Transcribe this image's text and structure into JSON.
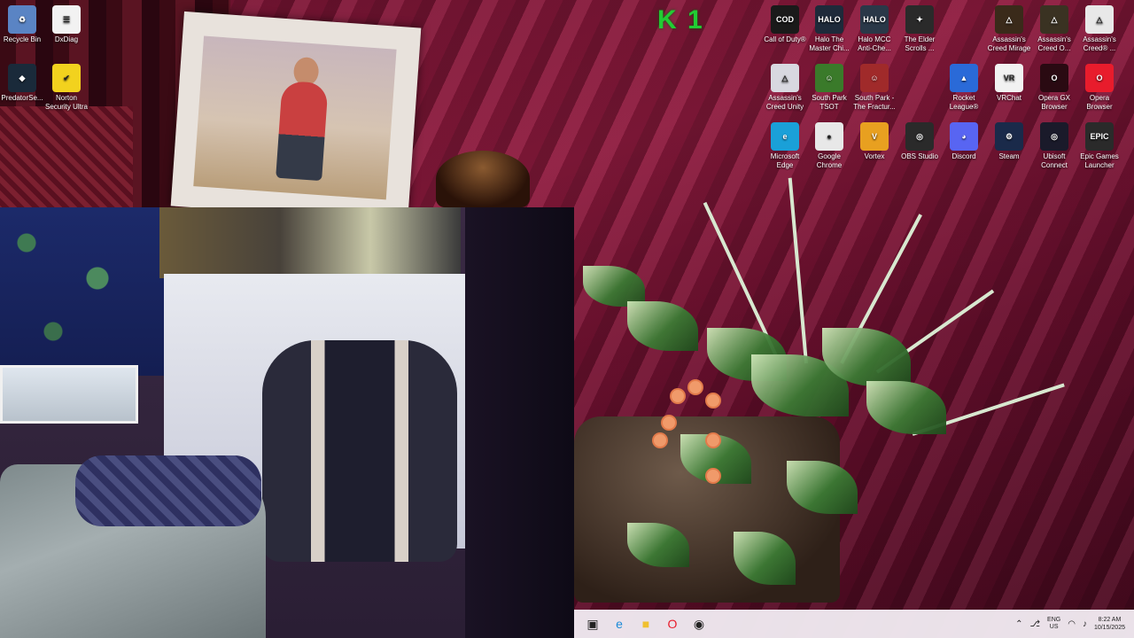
{
  "desktop": {
    "icons": [
      {
        "id": "recycle-bin",
        "label": "Recycle Bin",
        "glyph": "♻",
        "color": "#5a84c4"
      },
      {
        "id": "dxdiag",
        "label": "DxDiag",
        "glyph": "☰",
        "color": "#f2f2f2"
      },
      {
        "id": "predatorsense",
        "label": "PredatorSe...",
        "glyph": "◆",
        "color": "#1a2a3a"
      },
      {
        "id": "norton",
        "label": "Norton Security Ultra",
        "glyph": "✔",
        "color": "#f2d21e"
      },
      {
        "id": "call-of-duty",
        "label": "Call of Duty®",
        "glyph": "COD",
        "color": "#1a1a1a"
      },
      {
        "id": "halo-mc",
        "label": "Halo The Master Chi...",
        "glyph": "HALO",
        "color": "#1e2a3a"
      },
      {
        "id": "halo-mcc",
        "label": "Halo MCC Anti-Che...",
        "glyph": "HALO",
        "color": "#2a3848"
      },
      {
        "id": "elder-scrolls",
        "label": "The Elder Scrolls ...",
        "glyph": "✦",
        "color": "#2a2a2a"
      },
      {
        "id": "ac-mirage",
        "label": "Assassin's Creed Mirage",
        "glyph": "△",
        "color": "#3a2a1a"
      },
      {
        "id": "ac-odyssey",
        "label": "Assassin's Creed O...",
        "glyph": "△",
        "color": "#3a3222"
      },
      {
        "id": "ac-other",
        "label": "Assassin's Creed® ...",
        "glyph": "△",
        "color": "#e8e8e8"
      },
      {
        "id": "ac-unity",
        "label": "Assassin's Creed Unity",
        "glyph": "△",
        "color": "#d8d8e0"
      },
      {
        "id": "south-park-tsot",
        "label": "South Park TSOT",
        "glyph": "☺",
        "color": "#3a7a2a"
      },
      {
        "id": "south-park-fbw",
        "label": "South Park - The Fractur...",
        "glyph": "☺",
        "color": "#a02a2a"
      },
      {
        "id": "rocket-league",
        "label": "Rocket League®",
        "glyph": "▲",
        "color": "#2a6ad8"
      },
      {
        "id": "vrchat",
        "label": "VRChat",
        "glyph": "VR",
        "color": "#f2f2f2"
      },
      {
        "id": "opera-gx",
        "label": "Opera GX Browser",
        "glyph": "O",
        "color": "#2a0a12"
      },
      {
        "id": "opera",
        "label": "Opera Browser",
        "glyph": "O",
        "color": "#e81c2c"
      },
      {
        "id": "edge",
        "label": "Microsoft Edge",
        "glyph": "e",
        "color": "#1aa0d8"
      },
      {
        "id": "chrome",
        "label": "Google Chrome",
        "glyph": "●",
        "color": "#e8e8e8"
      },
      {
        "id": "vortex",
        "label": "Vortex",
        "glyph": "V",
        "color": "#e8a020"
      },
      {
        "id": "obs",
        "label": "OBS Studio",
        "glyph": "◎",
        "color": "#2a2a2a"
      },
      {
        "id": "discord",
        "label": "Discord",
        "glyph": "◕",
        "color": "#5865f2"
      },
      {
        "id": "steam",
        "label": "Steam",
        "glyph": "⚙",
        "color": "#1a2a4a"
      },
      {
        "id": "ubisoft",
        "label": "Ubisoft Connect",
        "glyph": "◎",
        "color": "#1a1a2a"
      },
      {
        "id": "epic",
        "label": "Epic Games Launcher",
        "glyph": "EPIC",
        "color": "#2a2a2a"
      }
    ],
    "overlay_text": "K 1",
    "overlay_color": "#22cc33"
  },
  "taskbar": {
    "buttons": [
      {
        "id": "task-view",
        "glyph": "▣",
        "color": "#222222"
      },
      {
        "id": "edge",
        "glyph": "e",
        "color": "#1a8ad8"
      },
      {
        "id": "file-explorer",
        "glyph": "■",
        "color": "#f0c030"
      },
      {
        "id": "opera",
        "glyph": "O",
        "color": "#e81c2c"
      },
      {
        "id": "obs",
        "glyph": "◉",
        "color": "#222222"
      }
    ],
    "tray": {
      "chevron": "⌃",
      "mic": "⎇",
      "lang_line1": "ENG",
      "lang_line2": "US",
      "wifi": "◠",
      "volume": "♪",
      "time": "8:22 AM",
      "date": "10/15/2025"
    }
  }
}
